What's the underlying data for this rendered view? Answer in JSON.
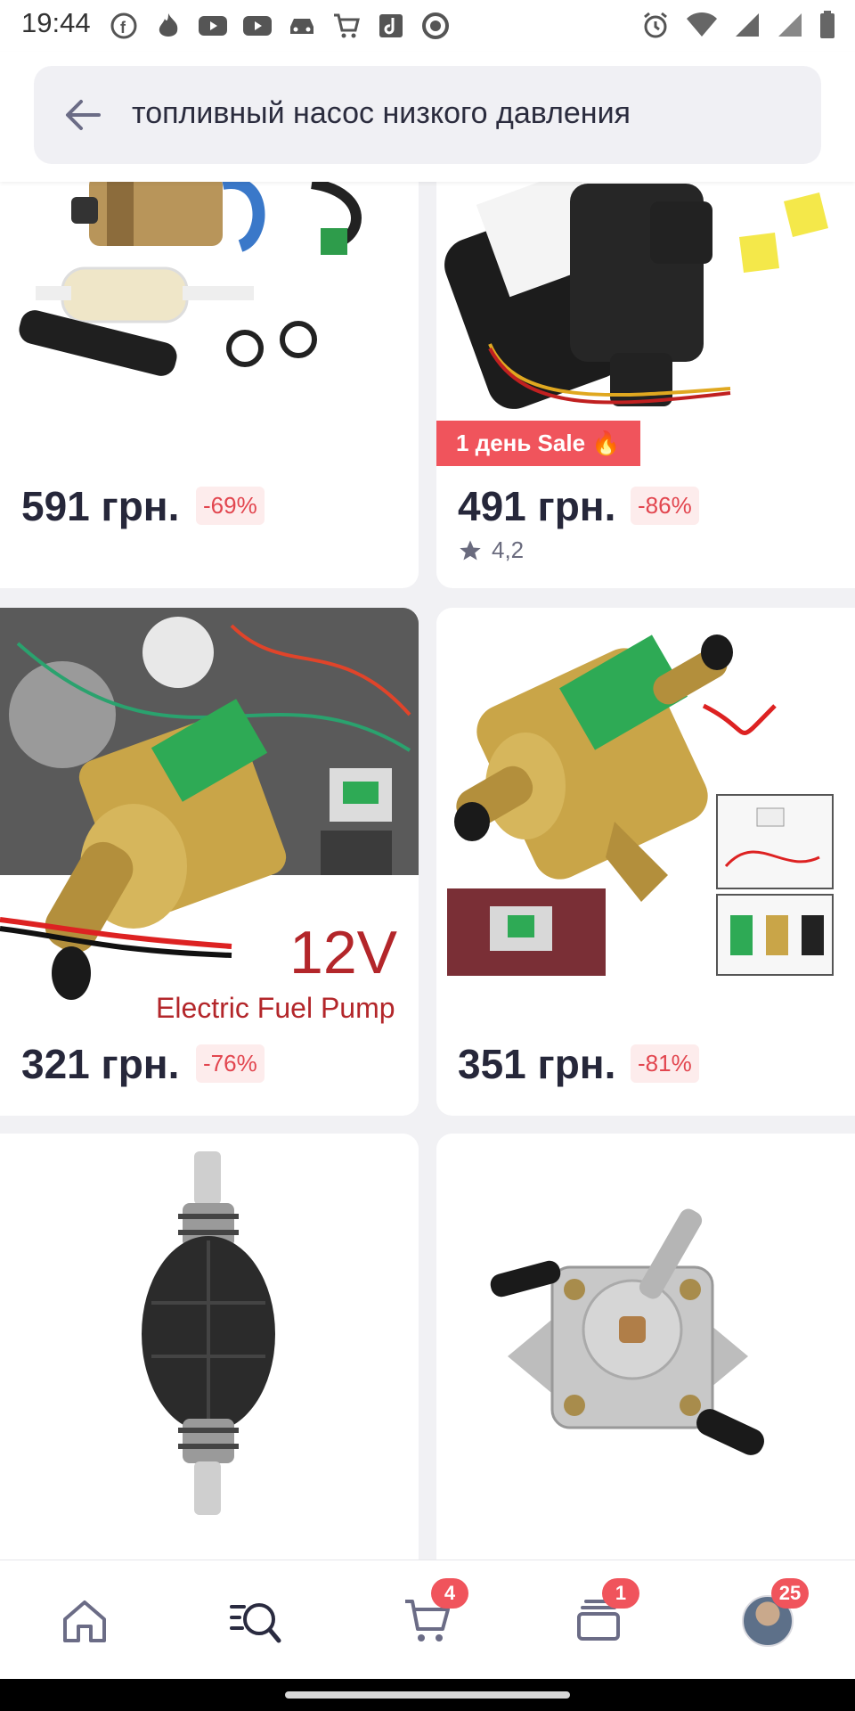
{
  "status_bar": {
    "time": "19:44",
    "icons": [
      "facebook-icon",
      "fire-icon",
      "youtube-icon",
      "youtube-icon",
      "car-icon",
      "cart-icon",
      "music-icon",
      "record-icon"
    ],
    "right_icons": [
      "alarm-icon",
      "wifi-icon",
      "signal-icon",
      "signal-icon",
      "battery-icon"
    ]
  },
  "search": {
    "query": "топливный насос низкого давления"
  },
  "products": [
    {
      "price": "591 грн.",
      "discount": "-69%"
    },
    {
      "price": "491 грн.",
      "discount": "-86%",
      "sale_badge": "1 день Sale 🔥",
      "rating": "4,2"
    },
    {
      "price": "321 грн.",
      "discount": "-76%",
      "image_text": "12V",
      "image_caption": "Electric Fuel Pump"
    },
    {
      "price": "351 грн.",
      "discount": "-81%"
    },
    {
      "price": "",
      "discount": ""
    },
    {
      "price": "",
      "discount": ""
    }
  ],
  "bottom_nav": {
    "cart_badge": "4",
    "orders_badge": "1",
    "profile_badge": "25"
  },
  "colors": {
    "accent": "#f0545c",
    "background": "#f1f1f4",
    "price_text": "#26273a"
  }
}
